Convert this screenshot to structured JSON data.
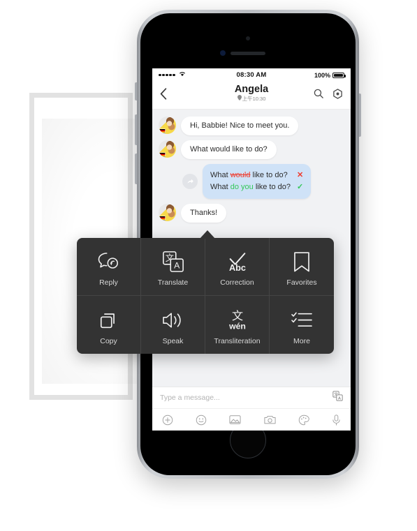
{
  "status_bar": {
    "signal_icon": "signal-dots-icon",
    "wifi_icon": "wifi-icon",
    "time": "08:30 AM",
    "battery_percent": "100%",
    "battery_icon": "battery-full-icon"
  },
  "nav": {
    "back_icon": "chevron-left-icon",
    "title": "Angela",
    "subtitle": "上午10:30",
    "location_icon": "location-pin-icon",
    "search_icon": "search-icon",
    "profile_icon": "circle-dot-icon"
  },
  "messages": [
    {
      "type": "incoming",
      "avatar_icon": "user-avatar",
      "flag_icon": "germany-flag-icon",
      "text": "Hi, Babbie!  Nice to meet you."
    },
    {
      "type": "incoming",
      "avatar_icon": "user-avatar",
      "flag_icon": "germany-flag-icon",
      "text": "What would like to do?"
    },
    {
      "type": "correction",
      "forward_icon": "forward-arrow-icon",
      "original": {
        "prefix": "What ",
        "error": "would",
        "suffix": " like to do?",
        "mark": "✕",
        "mark_name": "error-mark"
      },
      "corrected": {
        "prefix": "What ",
        "fix": "do you",
        "suffix": " like to do?",
        "mark": "✓",
        "mark_name": "correct-mark"
      }
    },
    {
      "type": "incoming",
      "avatar_icon": "user-avatar",
      "flag_icon": "germany-flag-icon",
      "text": "Thanks!"
    }
  ],
  "action_menu": {
    "items": [
      {
        "icon": "reply-bubble-icon",
        "label": "Reply"
      },
      {
        "icon": "translate-icon",
        "label": "Translate"
      },
      {
        "icon": "correction-abc-icon",
        "label": "Correction"
      },
      {
        "icon": "bookmark-icon",
        "label": "Favorites"
      },
      {
        "icon": "copy-icon",
        "label": "Copy"
      },
      {
        "icon": "speaker-icon",
        "label": "Speak"
      },
      {
        "icon": "transliteration-icon",
        "label": "Transliteration"
      },
      {
        "icon": "checklist-icon",
        "label": "More"
      }
    ],
    "transliteration_glyph": "文",
    "transliteration_pinyin": "wén",
    "correction_glyph": "Abc",
    "translate_glyph_cn": "文",
    "translate_glyph_en": "A"
  },
  "input_bar": {
    "placeholder": "Type a message...",
    "translate_icon": "translate-icon",
    "tools": [
      {
        "icon": "plus-circle-icon"
      },
      {
        "icon": "smiley-face-icon"
      },
      {
        "icon": "image-icon"
      },
      {
        "icon": "camera-icon"
      },
      {
        "icon": "palette-icon"
      },
      {
        "icon": "microphone-icon"
      }
    ]
  },
  "colors": {
    "menu_bg": "#333333",
    "correction_bubble": "#cfe2f7",
    "error": "#ef3b2d",
    "success": "#34c759",
    "screen_bg": "#f1f2f4"
  }
}
